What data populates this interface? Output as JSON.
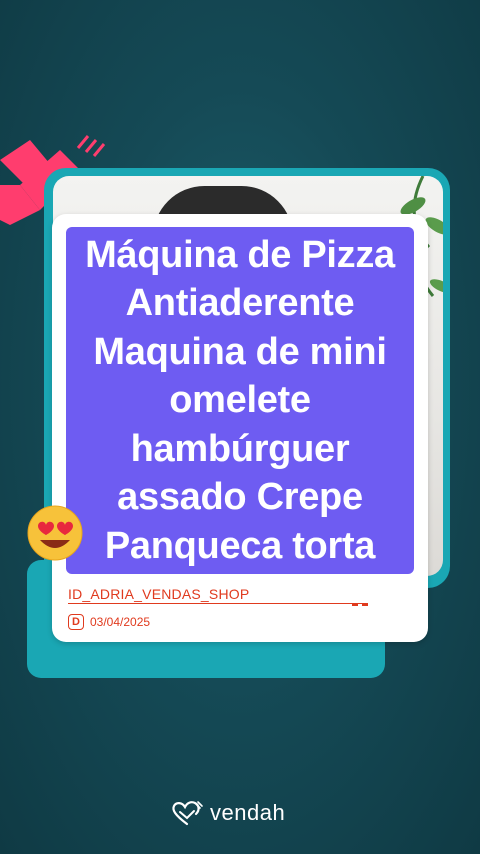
{
  "post": {
    "title": "Máquina de Pizza\nAntiaderente\nMaquina de mini\nomelete\nhambúrguer\nassado Crepe\nPanqueca torta",
    "shop_name": "ID_ADRIA_VENDAS_SHOP",
    "date_badge": "D",
    "date": "03/04/2025"
  },
  "brand": {
    "name": "vendah"
  },
  "colors": {
    "title_box": "#6e5cf2",
    "frame": "#1aa7b4",
    "accent_red": "#e03a1e",
    "background": "#154a56",
    "slash_pink": "#ff3d6e"
  },
  "icons": {
    "emoji": "heart-eyes-emoji-icon",
    "brand_logo": "vendah-heart-logo-icon",
    "decoration": "pink-slash-decoration-icon"
  }
}
